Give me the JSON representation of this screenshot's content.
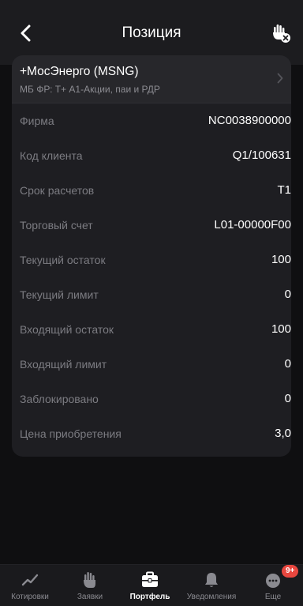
{
  "header": {
    "title": "Позиция",
    "back_icon": "chevron-left-icon",
    "action_icon": "hand-cancel-icon"
  },
  "instrument": {
    "name": "+МосЭнерго (MSNG)",
    "market": "МБ ФР: Т+ А1-Акции, паи и РДР",
    "chevron_icon": "chevron-right-icon"
  },
  "details": [
    {
      "label": "Фирма",
      "value": "NC0038900000"
    },
    {
      "label": "Код клиента",
      "value": "Q1/100631"
    },
    {
      "label": "Срок расчетов",
      "value": "T1"
    },
    {
      "label": "Торговый счет",
      "value": "L01-00000F00"
    },
    {
      "label": "Текущий остаток",
      "value": "100"
    },
    {
      "label": "Текущий лимит",
      "value": "0"
    },
    {
      "label": "Входящий остаток",
      "value": "100"
    },
    {
      "label": "Входящий лимит",
      "value": "0"
    },
    {
      "label": "Заблокировано",
      "value": "0"
    },
    {
      "label": "Цена приобретения",
      "value": "3,0"
    }
  ],
  "tabbar": {
    "items": [
      {
        "label": "Котировки",
        "icon": "trend-line-icon",
        "active": false
      },
      {
        "label": "Заявки",
        "icon": "hand-order-icon",
        "active": false
      },
      {
        "label": "Портфель",
        "icon": "briefcase-icon",
        "active": true
      },
      {
        "label": "Уведомления",
        "icon": "bell-icon",
        "active": false
      },
      {
        "label": "Еще",
        "icon": "more-dots-icon",
        "active": false,
        "badge": "9+"
      }
    ]
  },
  "colors": {
    "background": "#0f0f11",
    "header": "#1c1c1f",
    "card": "#1e1e22",
    "label": "#7c7c82",
    "badge": "#e8473f"
  }
}
